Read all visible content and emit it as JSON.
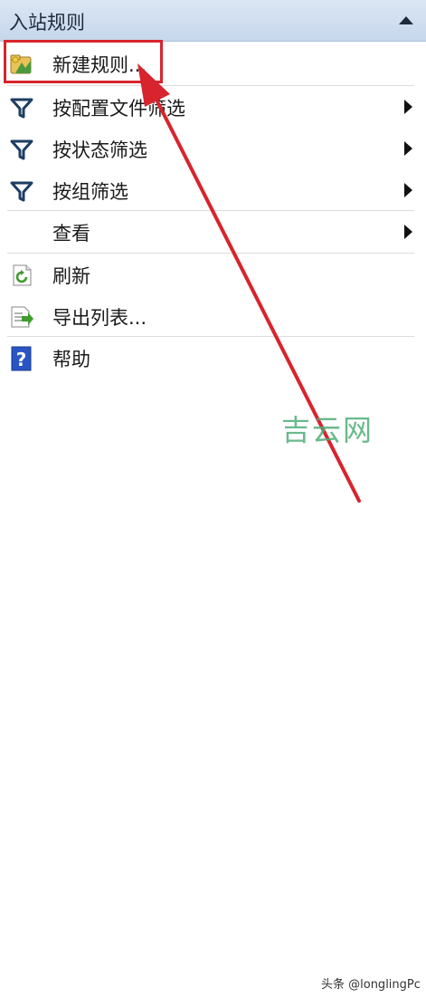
{
  "panel": {
    "title": "入站规则"
  },
  "menu": {
    "items": [
      {
        "label": "新建规则...",
        "icon": "new-rule-icon",
        "submenu": false
      },
      {
        "label": "按配置文件筛选",
        "icon": "filter-icon",
        "submenu": true
      },
      {
        "label": "按状态筛选",
        "icon": "filter-icon",
        "submenu": true
      },
      {
        "label": "按组筛选",
        "icon": "filter-icon",
        "submenu": true
      },
      {
        "label": "查看",
        "icon": "",
        "submenu": true
      },
      {
        "label": "刷新",
        "icon": "refresh-icon",
        "submenu": false
      },
      {
        "label": "导出列表...",
        "icon": "export-list-icon",
        "submenu": false
      },
      {
        "label": "帮助",
        "icon": "help-icon",
        "submenu": false
      }
    ]
  },
  "watermark": "吉云网",
  "attribution": "头条 @longlingPc",
  "colors": {
    "highlight": "#d8242d",
    "header_bg": "#c6d7ec",
    "watermark": "#4fae78"
  }
}
